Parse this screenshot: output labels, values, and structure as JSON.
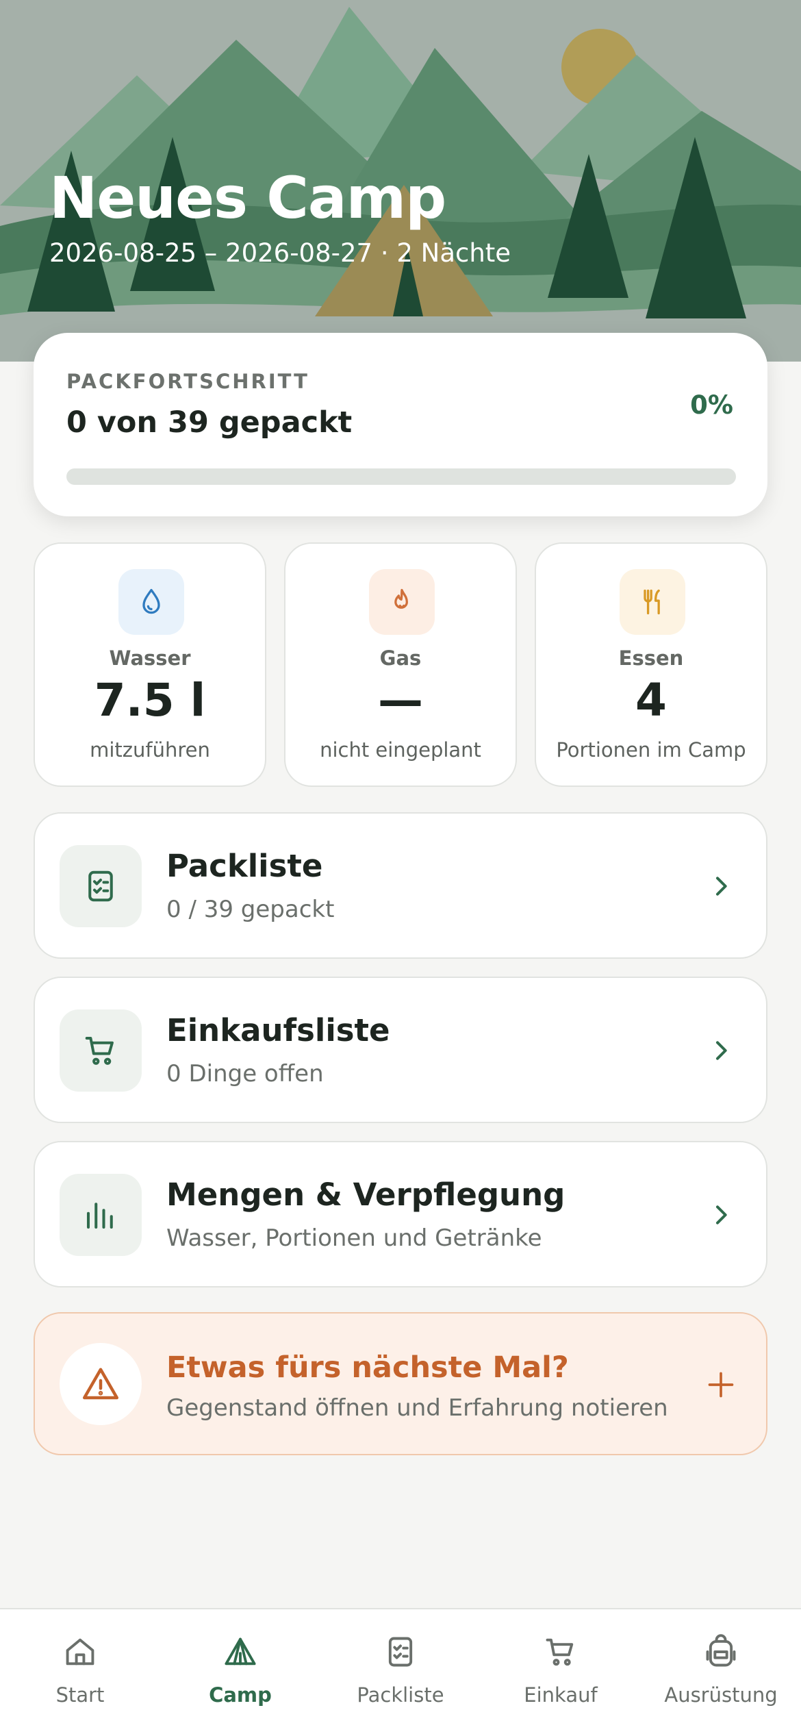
{
  "hero": {
    "title": "Neues Camp",
    "subtitle": "2026-08-25 – 2026-08-27 · 2 Nächte"
  },
  "progress": {
    "kicker": "PACKFORTSCHRITT",
    "text": "0 von 39 gepackt",
    "percent_label": "0%",
    "fraction": 0
  },
  "stats": [
    {
      "icon": "water-drop-icon",
      "label": "Wasser",
      "value": "7.5 l",
      "desc": "mitzuführen",
      "accent": "#2f7bbf",
      "bg": "#e8f2fb"
    },
    {
      "icon": "flame-icon",
      "label": "Gas",
      "value": "—",
      "desc": "nicht eingeplant",
      "accent": "#d0703a",
      "bg": "#fdeee4"
    },
    {
      "icon": "fork-knife-icon",
      "label": "Essen",
      "value": "4",
      "desc": "Portionen im Camp",
      "accent": "#d99a26",
      "bg": "#fdf3e2"
    }
  ],
  "nav_cards": [
    {
      "icon": "checklist-icon",
      "title": "Packliste",
      "subtitle": "0 / 39 gepackt"
    },
    {
      "icon": "cart-icon",
      "title": "Einkaufsliste",
      "subtitle": "0 Dinge offen"
    },
    {
      "icon": "bar-chart-icon",
      "title": "Mengen & Verpflegung",
      "subtitle": "Wasser, Portionen und Getränke"
    }
  ],
  "tip": {
    "icon": "warning-triangle-icon",
    "title": "Etwas fürs nächste Mal?",
    "subtitle": "Gegenstand öffnen und Erfahrung notieren"
  },
  "tabbar": {
    "active": "Camp",
    "tabs": [
      {
        "icon": "house-icon",
        "label": "Start"
      },
      {
        "icon": "tent-icon",
        "label": "Camp"
      },
      {
        "icon": "checklist-icon",
        "label": "Packliste"
      },
      {
        "icon": "cart-icon",
        "label": "Einkauf"
      },
      {
        "icon": "backpack-icon",
        "label": "Ausrüstung"
      }
    ]
  },
  "colors": {
    "primary": "#2f6b4c",
    "accent_orange": "#c4622b",
    "background": "#f5f5f3"
  }
}
